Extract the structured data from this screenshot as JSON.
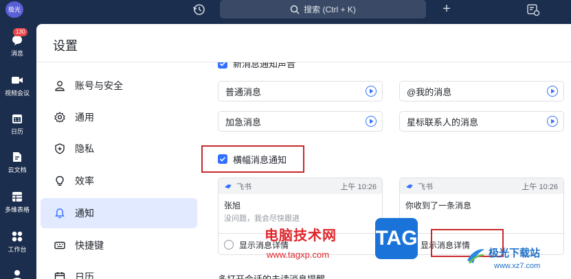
{
  "topbar": {
    "avatar_text": "极光",
    "search_placeholder": "搜索 (Ctrl + K)",
    "plus": "+"
  },
  "rail": {
    "items": [
      {
        "label": "消息",
        "icon": "chat-icon",
        "badge": "130"
      },
      {
        "label": "视频会议",
        "icon": "video-icon"
      },
      {
        "label": "日历",
        "icon": "calendar-icon"
      },
      {
        "label": "云文档",
        "icon": "doc-icon"
      },
      {
        "label": "多维表格",
        "icon": "table-icon"
      },
      {
        "label": "工作台",
        "icon": "apps-icon"
      }
    ]
  },
  "settings": {
    "title": "设置",
    "nav": [
      {
        "label": "账号与安全",
        "icon": "user-icon"
      },
      {
        "label": "通用",
        "icon": "gear-icon"
      },
      {
        "label": "隐私",
        "icon": "shield-icon"
      },
      {
        "label": "效率",
        "icon": "bulb-icon"
      },
      {
        "label": "通知",
        "icon": "bell-icon",
        "active": true
      },
      {
        "label": "快捷键",
        "icon": "keyboard-icon"
      },
      {
        "label": "日历",
        "icon": "calendar-icon"
      }
    ]
  },
  "notifications": {
    "new_msg_sound": "新消息通知声音",
    "sounds": [
      "普通消息",
      "@我的消息",
      "加急消息",
      "星标联系人的消息"
    ],
    "banner_label": "横幅消息通知",
    "previews": [
      {
        "app": "飞书",
        "time": "上午 10:26",
        "title": "张旭",
        "subtitle": "没问题，我会尽快跟进",
        "option": "显示消息详情"
      },
      {
        "app": "飞书",
        "time": "上午 10:26",
        "title": "你收到了一条消息",
        "subtitle": "",
        "option": "显示消息详情"
      }
    ],
    "next_section": "多打开会话的未读消息提醒"
  },
  "watermark": {
    "site_cn": "电脑技术网",
    "site_url": "www.tagxp.com",
    "tag": "TAG",
    "logo_cn": "极光下载站",
    "logo_url": "www.xz7.com"
  },
  "colors": {
    "accent": "#3370ff",
    "highlight": "#c7282c",
    "rail_bg": "#1c2e4d"
  }
}
